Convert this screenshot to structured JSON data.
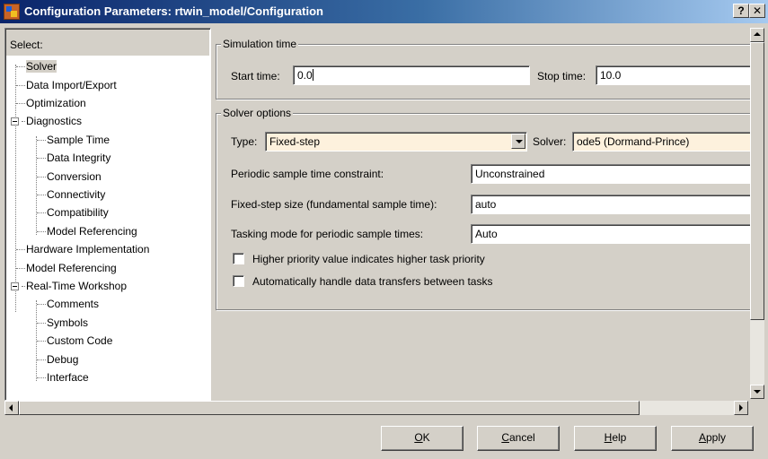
{
  "window": {
    "title": "Configuration Parameters: rtwin_model/Configuration",
    "help_label": "?",
    "close_label": "✕"
  },
  "tree": {
    "header": "Select:",
    "items": [
      {
        "label": "Solver",
        "level": 1,
        "selected": true
      },
      {
        "label": "Data Import/Export",
        "level": 1
      },
      {
        "label": "Optimization",
        "level": 1
      },
      {
        "label": "Diagnostics",
        "level": 0,
        "expanded": true
      },
      {
        "label": "Sample Time",
        "level": 2
      },
      {
        "label": "Data Integrity",
        "level": 2
      },
      {
        "label": "Conversion",
        "level": 2
      },
      {
        "label": "Connectivity",
        "level": 2
      },
      {
        "label": "Compatibility",
        "level": 2
      },
      {
        "label": "Model Referencing",
        "level": 2
      },
      {
        "label": "Hardware Implementation",
        "level": 1
      },
      {
        "label": "Model Referencing",
        "level": 1
      },
      {
        "label": "Real-Time Workshop",
        "level": 0,
        "expanded": true
      },
      {
        "label": "Comments",
        "level": 2
      },
      {
        "label": "Symbols",
        "level": 2
      },
      {
        "label": "Custom Code",
        "level": 2
      },
      {
        "label": "Debug",
        "level": 2
      },
      {
        "label": "Interface",
        "level": 2
      }
    ]
  },
  "simulation_time": {
    "group_title": "Simulation time",
    "start_label": "Start time:",
    "start_value": "0.0",
    "stop_label": "Stop time:",
    "stop_value": "10.0"
  },
  "solver_options": {
    "group_title": "Solver options",
    "type_label": "Type:",
    "type_value": "Fixed-step",
    "solver_label": "Solver:",
    "solver_value": "ode5 (Dormand-Prince)",
    "periodic_label": "Periodic sample time constraint:",
    "periodic_value": "Unconstrained",
    "step_size_label": "Fixed-step size (fundamental sample time):",
    "step_size_value": "auto",
    "tasking_label": "Tasking mode for periodic sample times:",
    "tasking_value": "Auto",
    "checkbox1_label": "Higher priority value indicates higher task priority",
    "checkbox1_checked": false,
    "checkbox2_label": "Automatically handle data transfers between tasks",
    "checkbox2_checked": false
  },
  "buttons": {
    "ok": {
      "accel": "O",
      "rest": "K"
    },
    "cancel": {
      "accel": "C",
      "rest": "ancel"
    },
    "help": {
      "accel": "H",
      "rest": "elp"
    },
    "apply": {
      "accel": "A",
      "rest": "pply"
    }
  },
  "icons": {
    "app": "simulink-config-icon",
    "colors": {
      "titlebar_start": "#0a246a",
      "titlebar_end": "#a6caf0",
      "face": "#d4d0c8",
      "field_tan": "#fdf1dd"
    }
  }
}
